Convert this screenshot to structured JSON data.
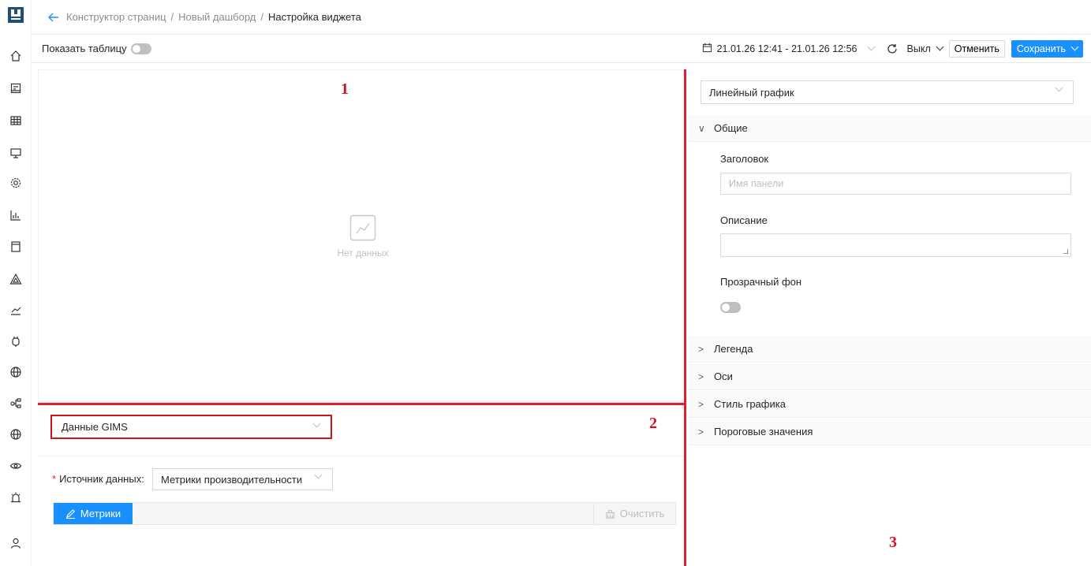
{
  "breadcrumb": {
    "items": [
      "Конструктор страниц",
      "Новый дашборд"
    ],
    "current": "Настройка виджета",
    "separator": "/"
  },
  "toolbar": {
    "show_table_label": "Показать таблицу",
    "time_range": "21.01.26 12:41 - 21.01.26 12:56",
    "refresh_value": "Выкл",
    "cancel_label": "Отменить",
    "save_label": "Сохранить"
  },
  "preview": {
    "no_data_text": "Нет данных",
    "marker": "1"
  },
  "query": {
    "source_type": "Данные GIMS",
    "marker": "2",
    "datasource_label": "Источник данных",
    "datasource_colon": ":",
    "required_mark": "*",
    "datasource_value": "Метрики производительности",
    "metrics_button": "Метрики",
    "clear_button": "Очистить"
  },
  "settings": {
    "chart_type": "Линейный график",
    "marker": "3",
    "sections": {
      "general": "Общие",
      "legend": "Легенда",
      "axes": "Оси",
      "chart_style": "Стиль графика",
      "thresholds": "Пороговые значения"
    },
    "general": {
      "title_label": "Заголовок",
      "title_placeholder": "Имя панели",
      "description_label": "Описание",
      "transparent_label": "Прозрачный фон"
    }
  },
  "colors": {
    "accent": "#1890ff",
    "annotation": "#d0121c"
  },
  "icons": {
    "rail": [
      "home-icon",
      "dashboard-icon",
      "table-icon",
      "monitor-icon",
      "settings-icon",
      "bar-chart-icon",
      "bookmark-icon",
      "alert-triangle-icon",
      "line-chart-icon",
      "plugin-icon",
      "globe-icon",
      "topology-icon",
      "globe-icon",
      "eye-icon",
      "alarm-icon",
      "user-icon"
    ]
  }
}
